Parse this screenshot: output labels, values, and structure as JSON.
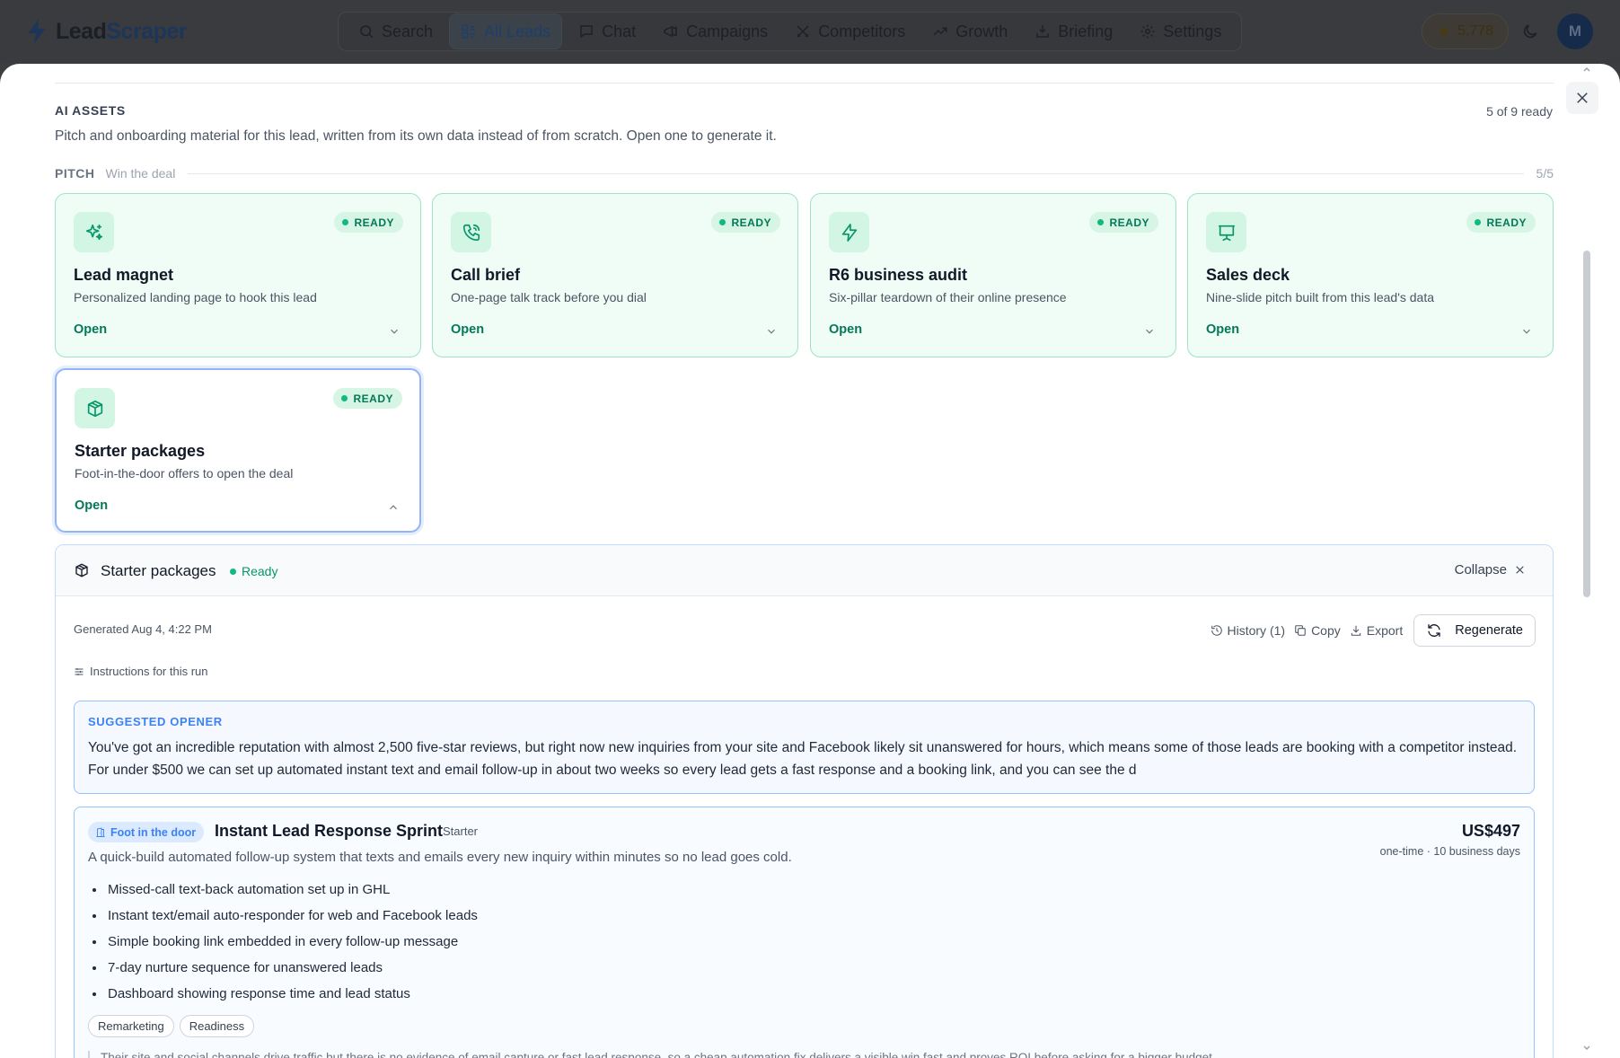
{
  "app": {
    "brand_prefix": "Lead",
    "brand_suffix": "Scraper",
    "credits": "5,778",
    "avatar_initial": "M"
  },
  "nav": {
    "items": [
      {
        "label": "Search",
        "icon": "search-icon"
      },
      {
        "label": "All Leads",
        "icon": "grid-list-icon",
        "active": true
      },
      {
        "label": "Chat",
        "icon": "chat-icon"
      },
      {
        "label": "Campaigns",
        "icon": "megaphone-icon"
      },
      {
        "label": "Competitors",
        "icon": "swords-icon"
      },
      {
        "label": "Growth",
        "icon": "trend-up-icon"
      },
      {
        "label": "Briefing",
        "icon": "briefing-icon"
      },
      {
        "label": "Settings",
        "icon": "gear-icon"
      }
    ]
  },
  "assets": {
    "heading": "AI ASSETS",
    "ready_count": "5 of 9 ready",
    "description": "Pitch and onboarding material for this lead, written from its own data instead of from scratch. Open one to generate it."
  },
  "pitch_group": {
    "title": "PITCH",
    "subtitle": "Win the deal",
    "count": "5/5"
  },
  "cards": [
    {
      "title": "Lead magnet",
      "desc": "Personalized landing page to hook this lead",
      "status": "READY",
      "action": "Open",
      "icon": "sparkle-icon"
    },
    {
      "title": "Call brief",
      "desc": "One-page talk track before you dial",
      "status": "READY",
      "action": "Open",
      "icon": "phone-icon"
    },
    {
      "title": "R6 business audit",
      "desc": "Six-pillar teardown of their online presence",
      "status": "READY",
      "action": "Open",
      "icon": "bolt-icon"
    },
    {
      "title": "Sales deck",
      "desc": "Nine-slide pitch built from this lead's data",
      "status": "READY",
      "action": "Open",
      "icon": "presentation-icon"
    },
    {
      "title": "Starter packages",
      "desc": "Foot-in-the-door offers to open the deal",
      "status": "READY",
      "action": "Open",
      "icon": "package-icon",
      "expanded": true
    }
  ],
  "panel": {
    "title": "Starter packages",
    "status": "Ready",
    "collapse_label": "Collapse",
    "generated": "Generated Aug 4, 4:22 PM",
    "history_label": "History (1)",
    "copy_label": "Copy",
    "export_label": "Export",
    "regenerate_label": "Regenerate",
    "instructions_label": "Instructions for this run",
    "opener_label": "SUGGESTED OPENER",
    "opener_text": "You've got an incredible reputation with almost 2,500 five-star reviews, but right now new inquiries from your site and Facebook likely sit unanswered for hours, which means some of those leads are booking with a competitor instead. For under $500 we can set up automated instant text and email follow-up in about two weeks so every lead gets a fast response and a booking link, and you can see the d"
  },
  "offer": {
    "tag": "Foot in the door",
    "name": "Instant Lead Response Sprint",
    "tier": "Starter",
    "price": "US$497",
    "terms": "one-time · 10 business days",
    "description": "A quick-build automated follow-up system that texts and emails every new inquiry within minutes so no lead goes cold.",
    "deliverables": [
      "Missed-call text-back automation set up in GHL",
      "Instant text/email auto-responder for web and Facebook leads",
      "Simple booking link embedded in every follow-up message",
      "7-day nurture sequence for unanswered leads",
      "Dashboard showing response time and lead status"
    ],
    "chips": [
      "Remarketing",
      "Readiness"
    ],
    "note": "Their site and social channels drive traffic but there is no evidence of email capture or fast lead response, so a cheap automation fix delivers a visible win fast and proves ROI before asking for a bigger budget."
  },
  "colors": {
    "ready_green": "#059669",
    "accent_blue": "#3b82f6",
    "card_border": "#9ee3c4"
  }
}
